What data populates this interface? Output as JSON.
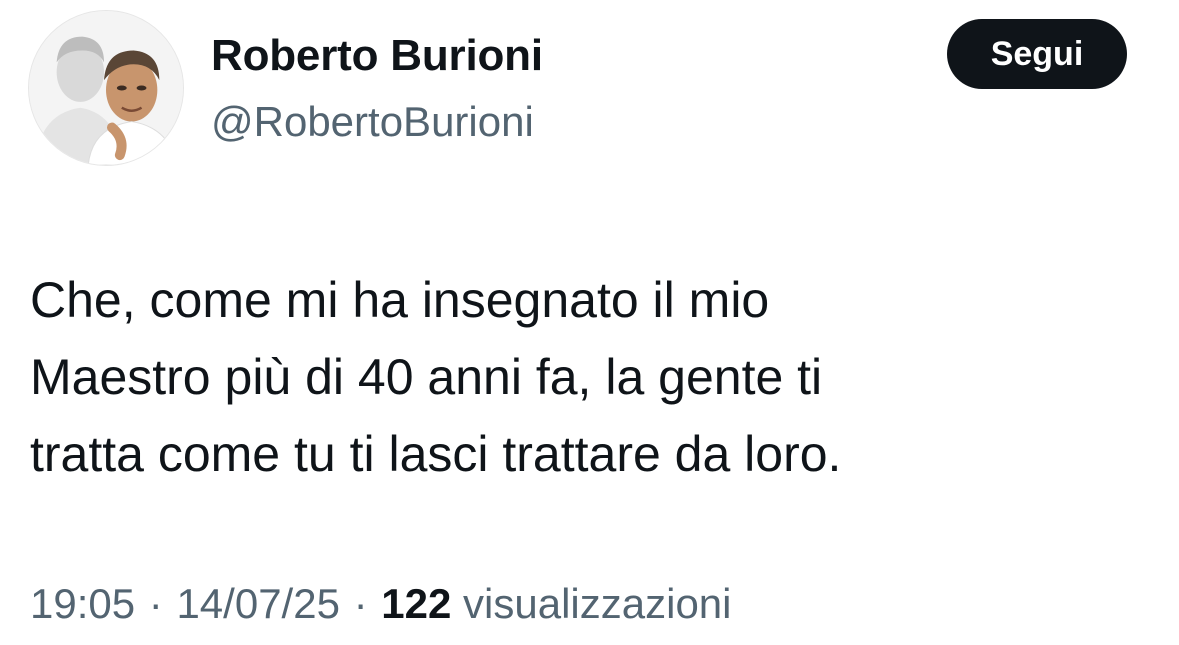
{
  "author": {
    "display_name": "Roberto Burioni",
    "handle": "@RobertoBurioni",
    "avatar_icon": "profile-photo-icon"
  },
  "follow_button": {
    "label": "Segui"
  },
  "tweet": {
    "lines": [
      "Che, come mi ha insegnato il mio",
      "Maestro più di 40 anni fa, la gente ti",
      "tratta come tu ti lasci trattare da loro."
    ]
  },
  "meta": {
    "time": "19:05",
    "separator": "·",
    "date": "14/07/25",
    "views_count": "122",
    "views_label": "visualizzazioni"
  },
  "colors": {
    "text_primary": "#0f1419",
    "text_secondary": "#536471",
    "button_bg": "#0f1419",
    "button_text": "#ffffff",
    "background": "#ffffff"
  }
}
